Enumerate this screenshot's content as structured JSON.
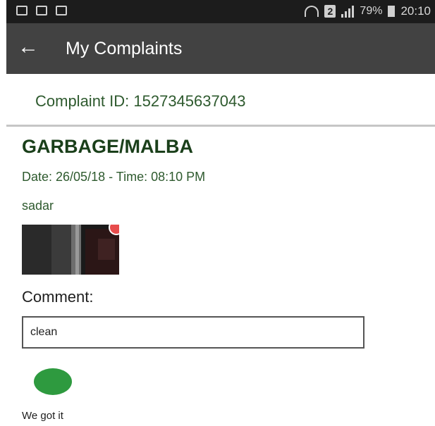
{
  "status_bar": {
    "sim_slot": "2",
    "battery_percent": "79%",
    "time": "20:10",
    "icons": [
      "gallery-icon",
      "mail-icon",
      "no-sim-icon",
      "wifi-icon",
      "signal-icon",
      "battery-icon"
    ]
  },
  "app_bar": {
    "back_icon": "back-arrow-icon",
    "title": "My Complaints"
  },
  "complaint": {
    "id_text": "Complaint ID: 1527345637043",
    "category": "GARBAGE/MALBA",
    "datetime": "Date: 26/05/18 - Time: 08:10 PM",
    "location": "sadar"
  },
  "comment": {
    "label": "Comment:",
    "value": "clean"
  },
  "status": {
    "color": "#2e9a3f",
    "text": "We got it"
  },
  "colors": {
    "app_bar": "#424242",
    "status_bar": "#1c1c1c",
    "accent_green": "#2e5a2e"
  }
}
